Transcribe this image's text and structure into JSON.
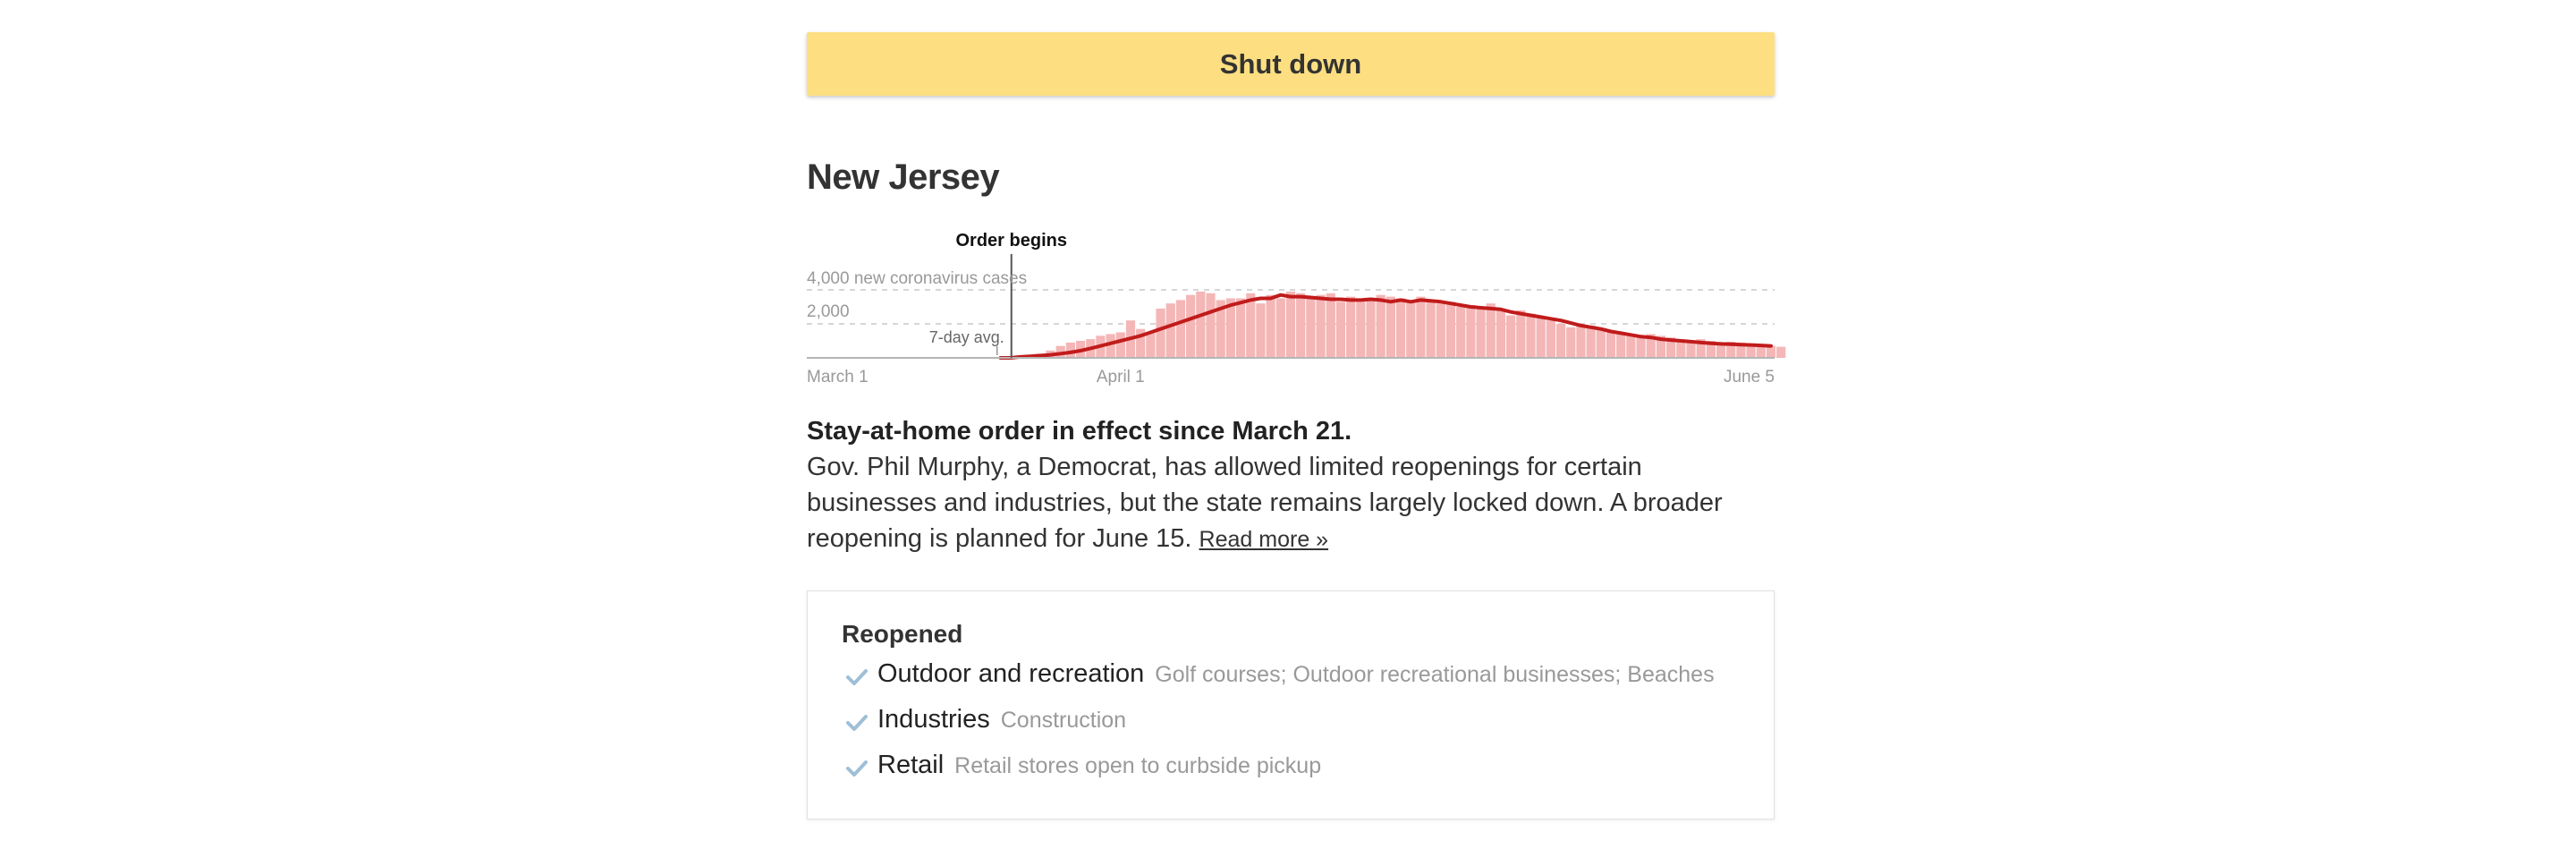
{
  "status": {
    "label": "Shut down",
    "color": "#fddf81"
  },
  "state": {
    "name": "New Jersey"
  },
  "chart_data": {
    "type": "bar",
    "title": "",
    "annotation": "Order begins",
    "annotation_date": "March 21",
    "ylabel": "new coronavirus cases",
    "y_ticks": [
      "4,000 new coronavirus cases",
      "2,000"
    ],
    "ylim": [
      0,
      4000
    ],
    "x_ticks": [
      "March 1",
      "April 1",
      "June 5"
    ],
    "avg_label": "7-day avg.",
    "grid": true,
    "bar_color": "#f4b6b6",
    "line_color": "#c11b1b",
    "series": [
      {
        "name": "new coronavirus cases",
        "start": "March 1",
        "values": [
          0,
          0,
          0,
          0,
          0,
          0,
          0,
          0,
          0,
          0,
          0,
          0,
          0,
          0,
          0,
          0,
          0,
          0,
          0,
          0,
          0,
          60,
          120,
          250,
          430,
          700,
          900,
          1000,
          1100,
          1300,
          1400,
          1500,
          2200,
          1700,
          1500,
          2900,
          3200,
          3400,
          3700,
          3900,
          3800,
          3400,
          3500,
          3500,
          3800,
          3200,
          3700,
          3500,
          3900,
          3800,
          3500,
          3700,
          3800,
          3300,
          3600,
          3300,
          3500,
          3700,
          3600,
          3500,
          3400,
          3600,
          3400,
          3200,
          3300,
          3000,
          3100,
          3000,
          3200,
          2800,
          2500,
          2800,
          2600,
          2400,
          2200,
          2000,
          1800,
          1900,
          1900,
          1700,
          1600,
          1500,
          1400,
          1300,
          1400,
          1300,
          1200,
          1100,
          1000,
          1100,
          1000,
          900,
          950,
          900,
          850,
          800,
          700,
          650
        ]
      },
      {
        "name": "7-day avg.",
        "start": "March 1",
        "values": [
          0,
          0,
          0,
          0,
          0,
          0,
          0,
          0,
          0,
          0,
          0,
          0,
          0,
          0,
          0,
          0,
          0,
          0,
          0,
          0,
          0,
          60,
          90,
          130,
          180,
          250,
          320,
          420,
          560,
          700,
          850,
          1000,
          1150,
          1300,
          1500,
          1700,
          1900,
          2100,
          2300,
          2500,
          2700,
          2900,
          3100,
          3250,
          3400,
          3500,
          3500,
          3700,
          3600,
          3600,
          3550,
          3500,
          3450,
          3450,
          3400,
          3400,
          3450,
          3400,
          3300,
          3400,
          3300,
          3400,
          3350,
          3300,
          3200,
          3100,
          3000,
          2950,
          2900,
          2850,
          2700,
          2600,
          2500,
          2400,
          2300,
          2200,
          2050,
          1900,
          1800,
          1700,
          1550,
          1450,
          1350,
          1250,
          1200,
          1100,
          1050,
          1000,
          950,
          900,
          850,
          820,
          800,
          780,
          760,
          730,
          700
        ]
      }
    ]
  },
  "summary": {
    "headline": "Stay-at-home order in effect since March 21.",
    "body": "Gov. Phil Murphy, a Democrat, has allowed limited reopenings for certain businesses and industries, but the state remains largely locked down. A broader reopening is planned for June 15.",
    "read_more": "Read more »"
  },
  "reopened": {
    "title": "Reopened",
    "icon": "check-icon",
    "items": [
      {
        "category": "Outdoor and recreation",
        "detail": "Golf courses; Outdoor recreational businesses; Beaches"
      },
      {
        "category": "Industries",
        "detail": "Construction"
      },
      {
        "category": "Retail",
        "detail": "Retail stores open to curbside pickup"
      }
    ]
  }
}
